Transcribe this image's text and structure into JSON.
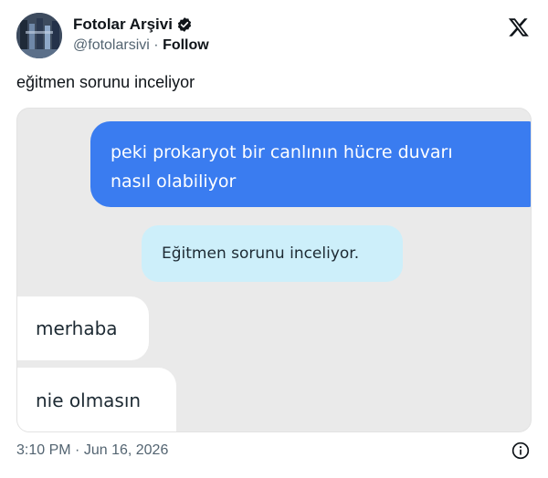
{
  "author": {
    "display_name": "Fotolar Arşivi",
    "handle": "@fotolarsivi",
    "separator": "·",
    "follow_label": "Follow",
    "verified_icon": "verified-badge-icon",
    "avatar_icon": "avatar-photo"
  },
  "platform": {
    "logo_icon": "x-logo-icon"
  },
  "tweet": {
    "text": "eğitmen sorunu inceliyor"
  },
  "media": {
    "messages": [
      {
        "line1": "peki prokaryot bir canlının hücre duvarı",
        "line2": "nasıl olabiliyor",
        "color": "#3a7cf0"
      },
      {
        "text": "Eğitmen sorunu inceliyor.",
        "color": "#cdeffa"
      },
      {
        "text": "merhaba",
        "color": "#ffffff"
      },
      {
        "text": "nie olmasın",
        "color": "#ffffff"
      }
    ]
  },
  "footer": {
    "time": "3:10 PM",
    "separator": "·",
    "date": "Jun 16, 2026",
    "info_icon": "info-icon"
  },
  "colors": {
    "verified_blue": "#1d9bf0",
    "text_primary": "#0f1419",
    "text_secondary": "#536471"
  }
}
